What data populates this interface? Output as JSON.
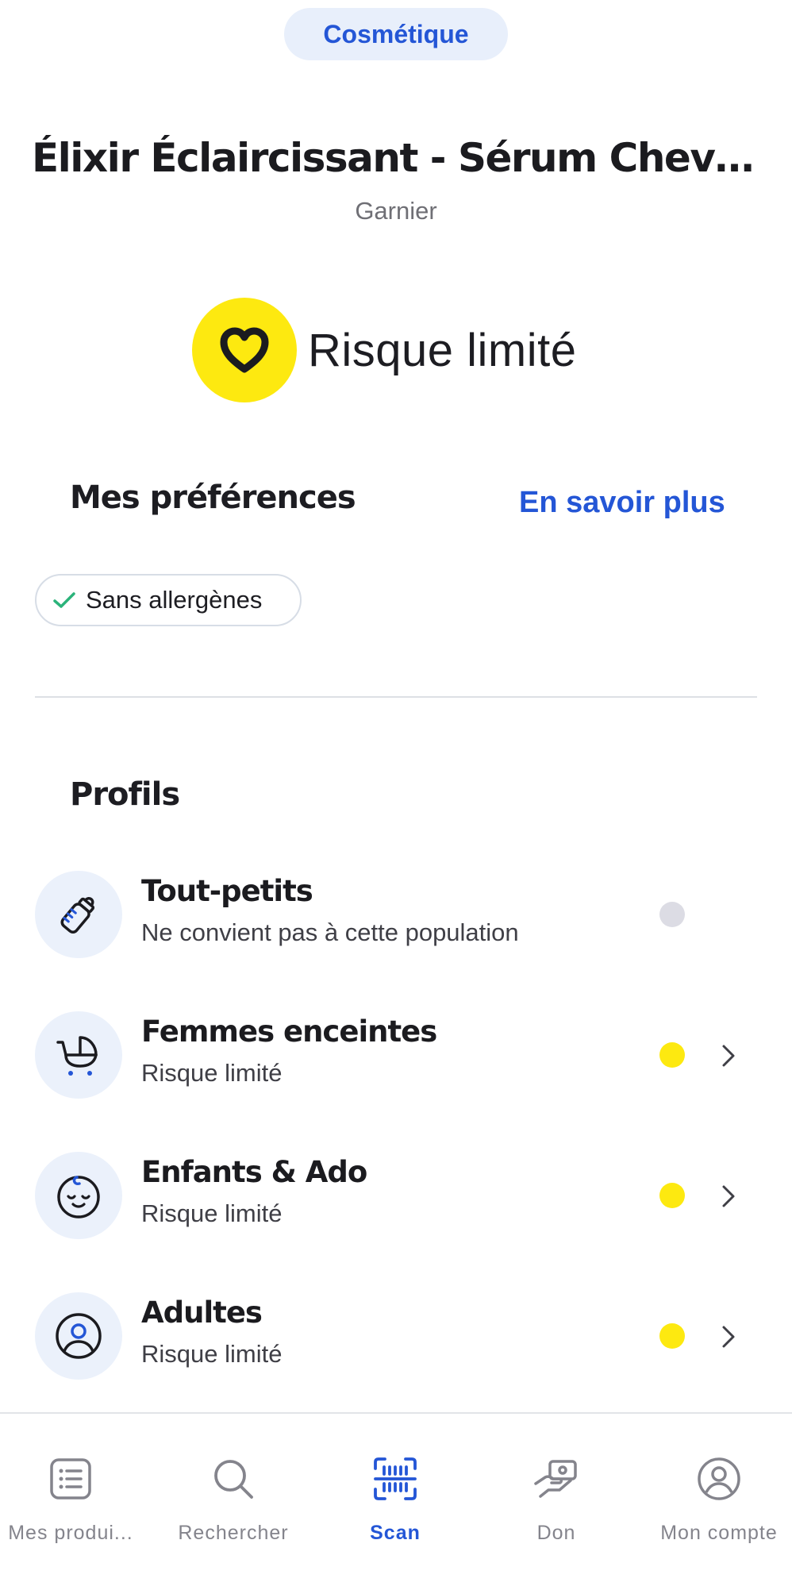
{
  "header": {
    "category": "Cosmétique",
    "product_title": "Élixir Éclaircissant - Sérum Cheveux ...",
    "brand": "Garnier"
  },
  "score": {
    "label": "Risque limité",
    "color": "#fde910",
    "icon": "heart-icon"
  },
  "preferences": {
    "title": "Mes préférences",
    "learn_more": "En savoir plus",
    "chips": [
      {
        "label": "Sans allergènes",
        "icon": "check-icon",
        "checked": true
      }
    ]
  },
  "profiles": {
    "title": "Profils",
    "items": [
      {
        "name": "Tout-petits",
        "status": "Ne convient pas à cette population",
        "dot_color": "#dcdce4",
        "icon": "baby-bottle-icon",
        "has_chevron": false
      },
      {
        "name": "Femmes enceintes",
        "status": "Risque limité",
        "dot_color": "#fde910",
        "icon": "stroller-icon",
        "has_chevron": true
      },
      {
        "name": "Enfants & Ado",
        "status": "Risque limité",
        "dot_color": "#fde910",
        "icon": "child-face-icon",
        "has_chevron": true
      },
      {
        "name": "Adultes",
        "status": "Risque limité",
        "dot_color": "#fde910",
        "icon": "adult-user-icon",
        "has_chevron": true
      }
    ]
  },
  "bottom_nav": {
    "items": [
      {
        "label": "Mes produi...",
        "icon": "list-icon",
        "active": false
      },
      {
        "label": "Rechercher",
        "icon": "search-icon",
        "active": false
      },
      {
        "label": "Scan",
        "icon": "barcode-scan-icon",
        "active": true
      },
      {
        "label": "Don",
        "icon": "donate-hand-icon",
        "active": false
      },
      {
        "label": "Mon compte",
        "icon": "account-icon",
        "active": false
      }
    ]
  },
  "colors": {
    "accent": "#2456d6",
    "risk_limited": "#fde910",
    "not_applicable": "#dcdce4"
  }
}
